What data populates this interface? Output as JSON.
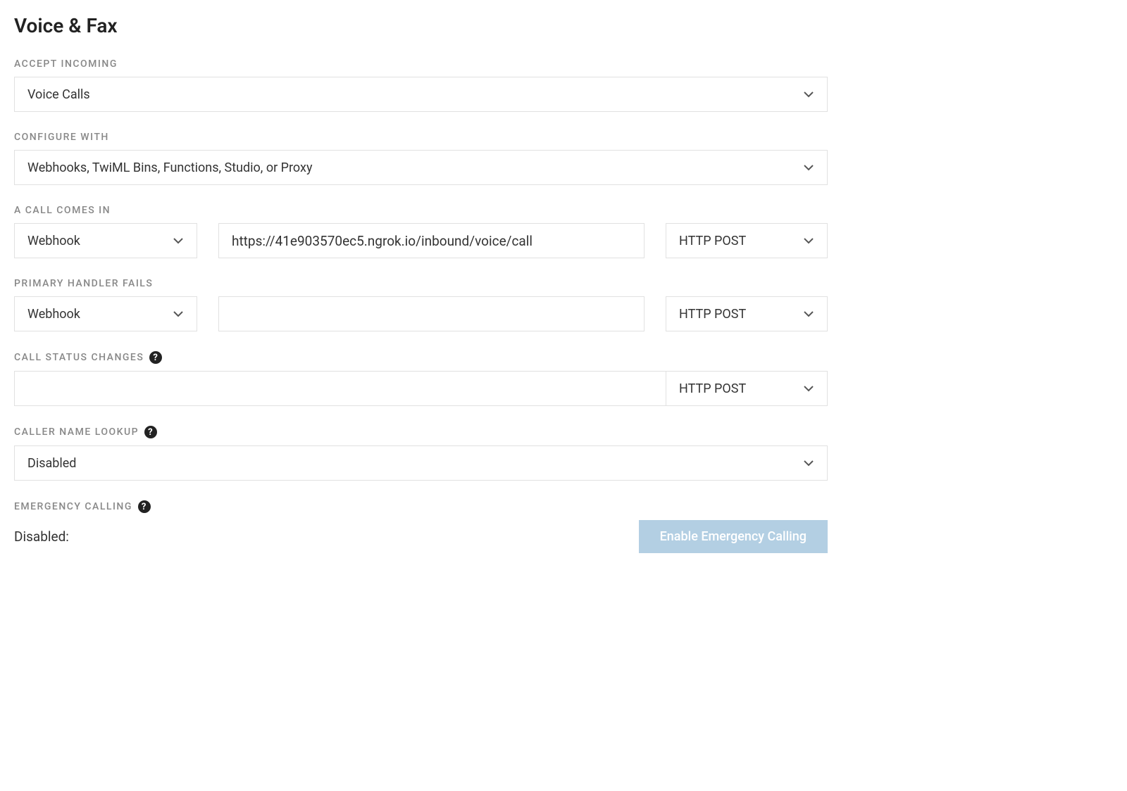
{
  "page": {
    "title": "Voice & Fax"
  },
  "accept_incoming": {
    "label": "ACCEPT INCOMING",
    "value": "Voice Calls"
  },
  "configure_with": {
    "label": "CONFIGURE WITH",
    "value": "Webhooks, TwiML Bins, Functions, Studio, or Proxy"
  },
  "call_comes_in": {
    "label": "A CALL COMES IN",
    "handler": "Webhook",
    "url": "https://41e903570ec5.ngrok.io/inbound/voice/call",
    "method": "HTTP POST"
  },
  "primary_handler_fails": {
    "label": "PRIMARY HANDLER FAILS",
    "handler": "Webhook",
    "url": "",
    "method": "HTTP POST"
  },
  "call_status_changes": {
    "label": "CALL STATUS CHANGES",
    "url": "",
    "method": "HTTP POST"
  },
  "caller_name_lookup": {
    "label": "CALLER NAME LOOKUP",
    "value": "Disabled"
  },
  "emergency_calling": {
    "label": "EMERGENCY CALLING",
    "status": "Disabled:",
    "button": "Enable Emergency Calling"
  },
  "help_tooltip": "?"
}
